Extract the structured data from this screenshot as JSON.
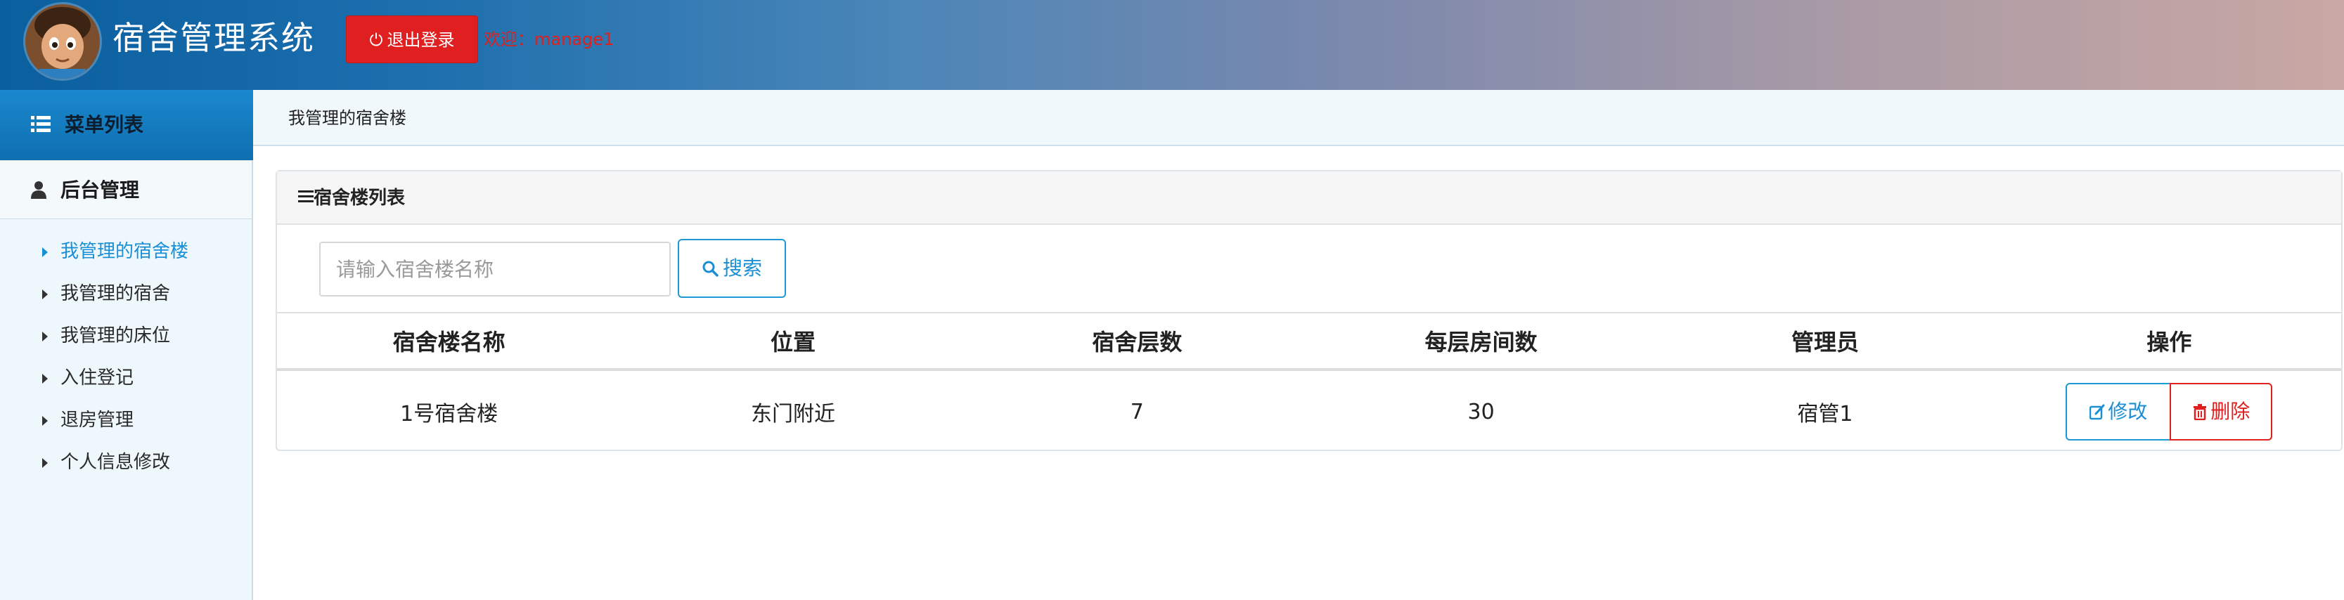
{
  "header": {
    "app_title": "宿舍管理系统",
    "logout_label": "退出登录",
    "welcome_text": "欢迎：manage1",
    "brand_color": "#1b6fae",
    "logout_color": "#e02020"
  },
  "sidebar": {
    "menu_title": "菜单列表",
    "menu_title_icon": "list-icon",
    "group_label": "后台管理",
    "group_icon": "user-icon",
    "items": [
      {
        "label": "我管理的宿舍楼",
        "active": true
      },
      {
        "label": "我管理的宿舍",
        "active": false
      },
      {
        "label": "我管理的床位",
        "active": false
      },
      {
        "label": "入住登记",
        "active": false
      },
      {
        "label": "退房管理",
        "active": false
      },
      {
        "label": "个人信息修改",
        "active": false
      }
    ]
  },
  "breadcrumb": {
    "current": "我管理的宿舍楼"
  },
  "panel": {
    "title": "宿舍楼列表",
    "title_icon": "bars-icon",
    "search": {
      "placeholder": "请输入宿舍楼名称",
      "value": "",
      "button_label": "搜索",
      "button_icon": "search-icon"
    },
    "table": {
      "headers": [
        "宿舍楼名称",
        "位置",
        "宿舍层数",
        "每层房间数",
        "管理员",
        "操作"
      ],
      "rows": [
        {
          "name": "1号宿舍楼",
          "location": "东门附近",
          "floors": "7",
          "rooms_per_floor": "30",
          "manager": "宿管1",
          "edit_label": "修改",
          "delete_label": "删除"
        }
      ]
    }
  }
}
